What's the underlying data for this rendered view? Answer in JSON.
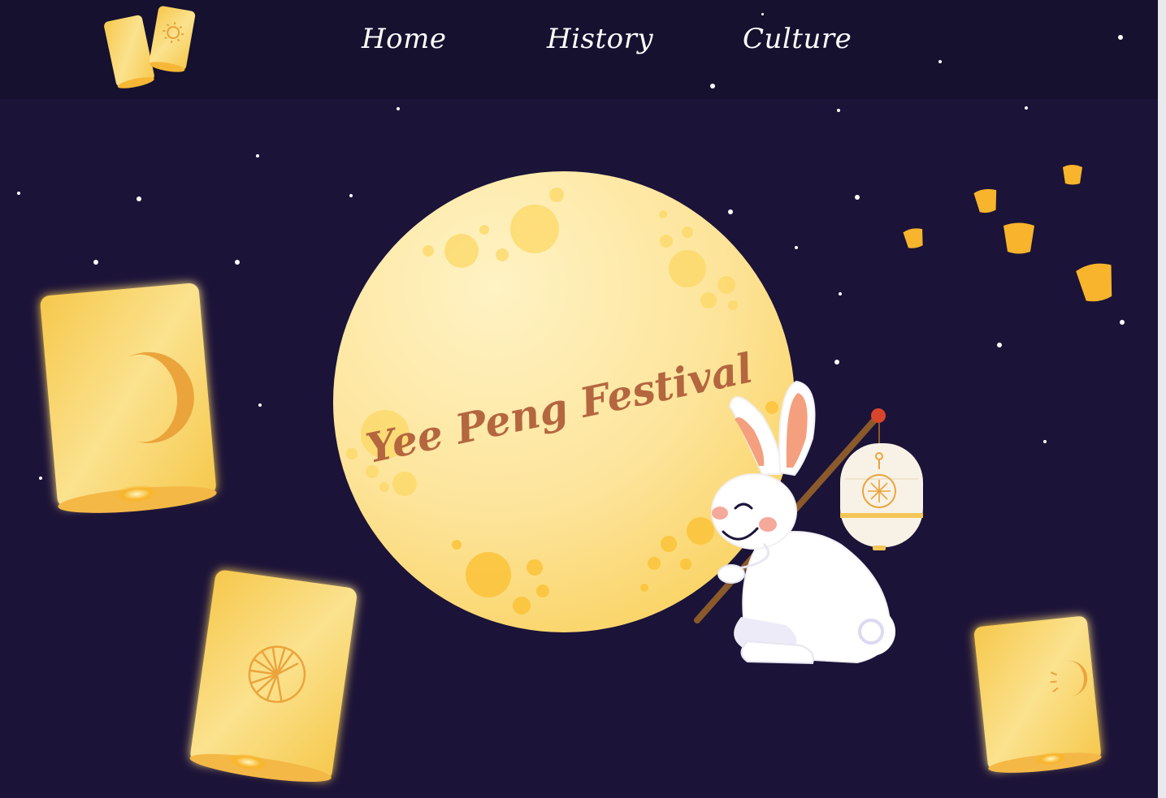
{
  "nav": {
    "items": [
      {
        "label": "Home"
      },
      {
        "label": "History"
      },
      {
        "label": "Culture"
      }
    ]
  },
  "hero": {
    "title": "Yee Peng Festival"
  },
  "colors": {
    "background": "#1c1338",
    "navbar": "#16112f",
    "moon": "#fbe08a",
    "lantern": "#f7cc55",
    "title": "#b4663f",
    "sky_lantern_small": "#f7b42c"
  },
  "icons": {
    "logo": "lantern-pair-logo",
    "moon": "full-moon",
    "rabbit": "moon-rabbit",
    "lantern_symbols": [
      "crescent-moon-icon",
      "sunburst-icon",
      "moon-sun-icon"
    ]
  }
}
